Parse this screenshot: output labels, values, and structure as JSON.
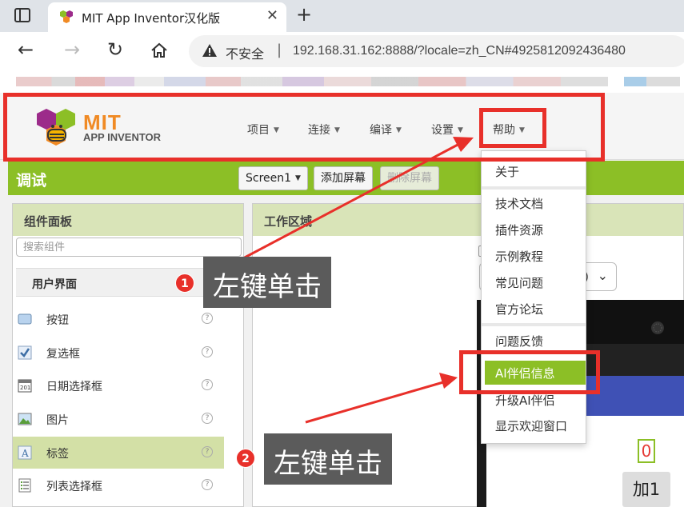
{
  "browser": {
    "tab_title": "MIT App Inventor汉化版",
    "insecure_label": "不安全",
    "url": "192.168.31.162:8888/?locale=zh_CN#4925812092436480"
  },
  "app": {
    "logo_main": "MIT",
    "logo_sub": "APP INVENTOR",
    "menu": [
      "项目",
      "连接",
      "编译",
      "设置",
      "帮助"
    ]
  },
  "toolbar": {
    "title": "调试",
    "screen_select": "Screen1",
    "add_screen": "添加屏幕",
    "remove_screen": "删除屏幕"
  },
  "palette": {
    "title": "组件面板",
    "search_placeholder": "搜索组件",
    "category": "用户界面",
    "items": [
      {
        "label": "按钮",
        "icon": "button-icon"
      },
      {
        "label": "复选框",
        "icon": "checkbox-icon"
      },
      {
        "label": "日期选择框",
        "icon": "calendar-icon"
      },
      {
        "label": "图片",
        "icon": "image-icon"
      },
      {
        "label": "标签",
        "icon": "label-icon"
      },
      {
        "label": "列表选择框",
        "icon": "list-icon"
      }
    ],
    "help_symbol": "?"
  },
  "workarea": {
    "title": "工作区域",
    "device_select_suffix": ")",
    "counter": "0",
    "add_button": "加1"
  },
  "help_menu": {
    "items": [
      "关于",
      "技术文档",
      "插件资源",
      "示例教程",
      "常见问题",
      "官方论坛",
      "问题反馈",
      "AI伴侣信息",
      "升级AI伴侣",
      "显示欢迎窗口"
    ]
  },
  "annotations": {
    "step1_number": "1",
    "step1_text": "左键单击",
    "step2_number": "2",
    "step2_text": "左键单击"
  },
  "colors": {
    "accent_green": "#8cbf26",
    "annotation_red": "#e8302a",
    "logo_orange": "#f08a24"
  }
}
